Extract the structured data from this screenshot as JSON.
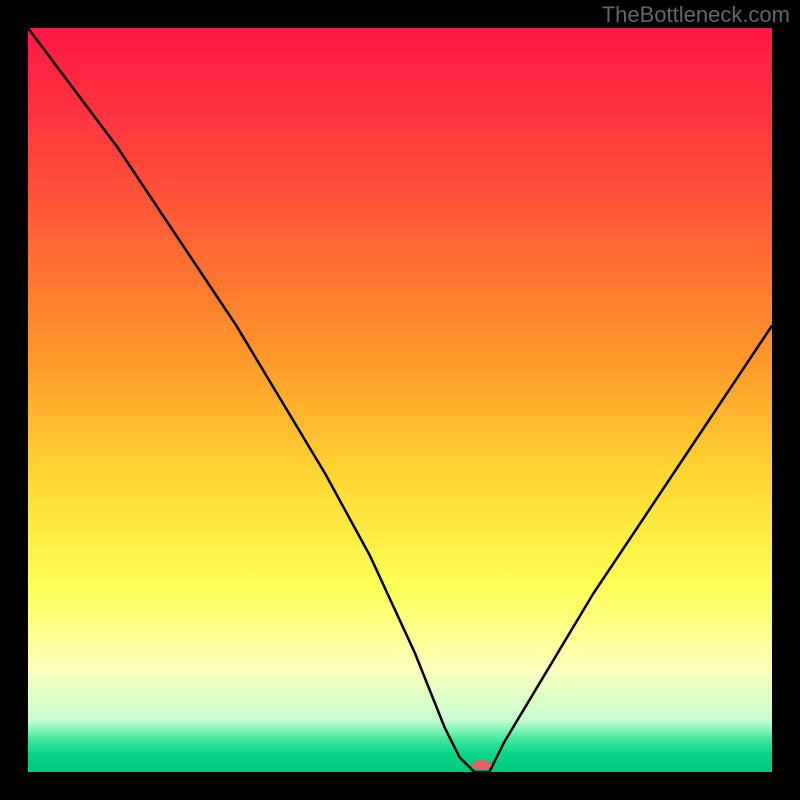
{
  "attribution": "TheBottleneck.com",
  "chart_data": {
    "type": "line",
    "title": "",
    "xlabel": "",
    "ylabel": "",
    "xlim": [
      0,
      100
    ],
    "ylim": [
      0,
      100
    ],
    "legend": false,
    "grid": false,
    "x": [
      0,
      6,
      12,
      18,
      24,
      28,
      34,
      40,
      46,
      52,
      56,
      58,
      60,
      62,
      64,
      70,
      76,
      82,
      88,
      94,
      100
    ],
    "values": [
      100,
      92,
      84,
      75,
      66,
      60,
      50,
      40,
      29,
      16,
      6,
      2,
      0,
      0,
      4,
      14,
      24,
      33,
      42,
      51,
      60
    ],
    "background_gradient": {
      "stops": [
        {
          "offset": 0.0,
          "color": "#ff1744"
        },
        {
          "offset": 0.2,
          "color": "#ff4a3a"
        },
        {
          "offset": 0.45,
          "color": "#ff9a2a"
        },
        {
          "offset": 0.6,
          "color": "#ffd633"
        },
        {
          "offset": 0.75,
          "color": "#ffff55"
        },
        {
          "offset": 0.86,
          "color": "#fcffba"
        },
        {
          "offset": 0.93,
          "color": "#c6ffd0"
        },
        {
          "offset": 0.955,
          "color": "#45e9a0"
        },
        {
          "offset": 0.975,
          "color": "#08d68a"
        },
        {
          "offset": 1.0,
          "color": "#00c878"
        }
      ]
    },
    "marker": {
      "x": 61,
      "y": 1,
      "color": "#e06666",
      "rx": 10,
      "ry": 5
    }
  }
}
